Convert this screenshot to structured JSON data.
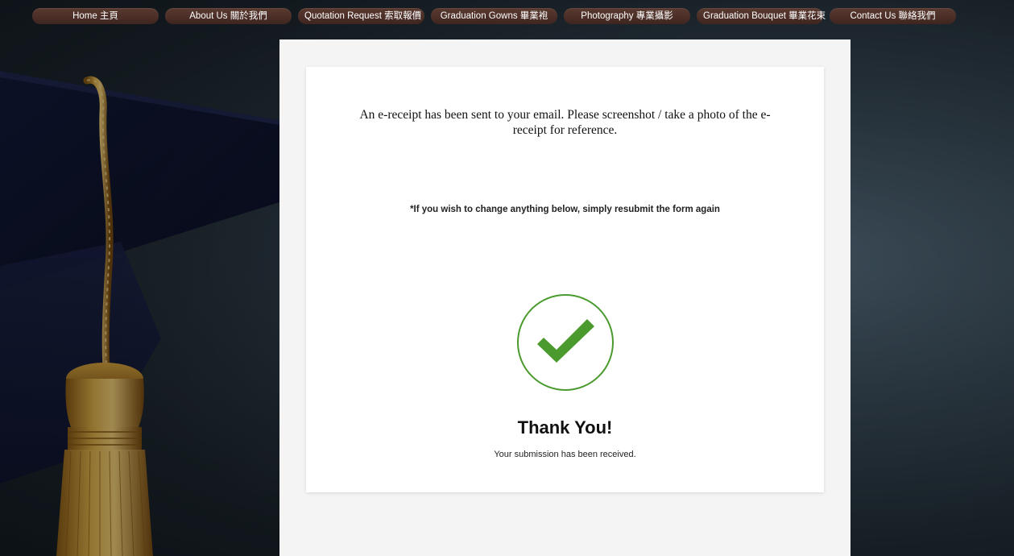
{
  "nav": {
    "items": [
      {
        "label": "Home 主頁"
      },
      {
        "label": "About Us 關於我們"
      },
      {
        "label": "Quotation Request 索取報價"
      },
      {
        "label": "Graduation Gowns 畢業袍"
      },
      {
        "label": "Photography 專業攝影"
      },
      {
        "label": "Graduation Bouquet 畢業花束"
      },
      {
        "label": "Contact Us 聯絡我們"
      }
    ]
  },
  "confirmation": {
    "receipt_message": "An e-receipt has been sent to your email.  Please screenshot / take a photo of the e-receipt for reference.",
    "change_note": "*If you wish to change anything below, simply resubmit the form again",
    "title": "Thank You!",
    "subtitle": "Your submission has been received."
  },
  "icons": {
    "success": "checkmark-circle-icon"
  },
  "colors": {
    "nav_bg": "#4a2e26",
    "success_green": "#4a9a2e",
    "panel_bg": "#f4f4f4",
    "card_bg": "#ffffff"
  }
}
